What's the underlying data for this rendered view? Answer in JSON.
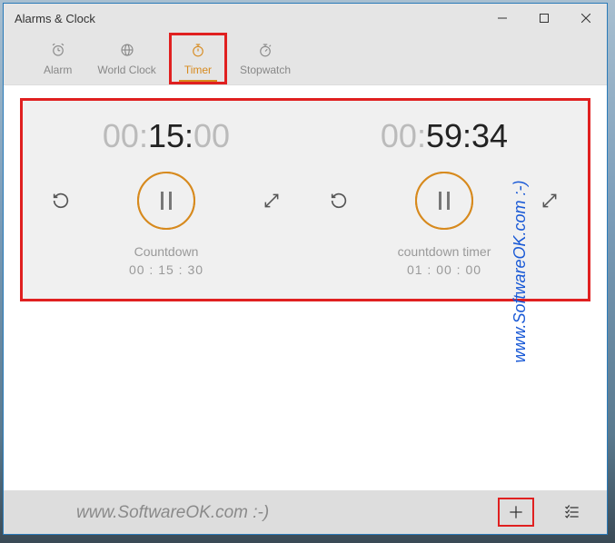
{
  "window": {
    "title": "Alarms & Clock"
  },
  "tabs": {
    "alarm": "Alarm",
    "worldclock": "World Clock",
    "timer": "Timer",
    "stopwatch": "Stopwatch"
  },
  "timers": [
    {
      "hours_dim": "00",
      "minutes": "15",
      "seconds": "00",
      "seconds_dim": true,
      "name": "Countdown",
      "original": "00 : 15 : 30"
    },
    {
      "hours_dim": "00",
      "minutes": "59",
      "seconds": "34",
      "seconds_dim": false,
      "name": "countdown timer",
      "original": "01 : 00 : 00"
    }
  ],
  "watermark": {
    "side": "www.SoftwareOK.com :-)",
    "bottom": "www.SoftwareOK.com :-)"
  }
}
